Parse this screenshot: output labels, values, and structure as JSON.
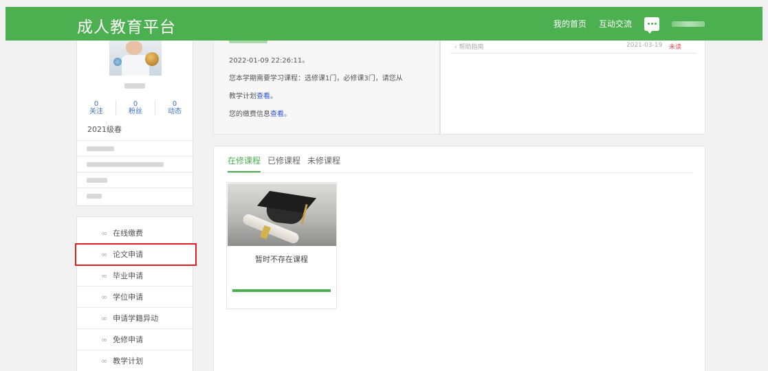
{
  "header": {
    "logo": "成人教育平台",
    "nav": {
      "home": "我的首页",
      "interaction": "互动交流"
    }
  },
  "profile": {
    "stats": [
      {
        "count": "0",
        "label": "关注"
      },
      {
        "count": "0",
        "label": "粉丝"
      },
      {
        "count": "0",
        "label": "动态"
      }
    ],
    "grade": "2021级春"
  },
  "menu": {
    "items": [
      {
        "label": "在线缴费"
      },
      {
        "label": "论文申请"
      },
      {
        "label": "毕业申请"
      },
      {
        "label": "学位申请"
      },
      {
        "label": "申请学籍异动"
      },
      {
        "label": "免修申请"
      },
      {
        "label": "教学计划"
      }
    ],
    "highlighted_index": 1,
    "highlight_color": "#e02020"
  },
  "notice": {
    "last_login_time": "2022-01-09 22:26:11。",
    "courses_line": "您本学期需要学习课程：选修课1门，必修课3门，请您从",
    "plan_prefix": "教学计划",
    "plan_link": "查看。",
    "fee_prefix": "您的缴费信息",
    "fee_link": "查看。"
  },
  "news": {
    "rows": [
      {
        "title": "帮助指南",
        "date": "2021-03-19",
        "status": "未读"
      }
    ]
  },
  "courses": {
    "tabs": [
      {
        "label": "在修课程",
        "active": true
      },
      {
        "label": "已修课程",
        "active": false
      },
      {
        "label": "未修课程",
        "active": false
      }
    ],
    "card": {
      "title": "暂时不存在课程",
      "progress": 1.0
    }
  },
  "colors": {
    "brand_green": "#4caf50",
    "link_blue": "#2b55c8",
    "unread_red": "#e34b4b"
  }
}
